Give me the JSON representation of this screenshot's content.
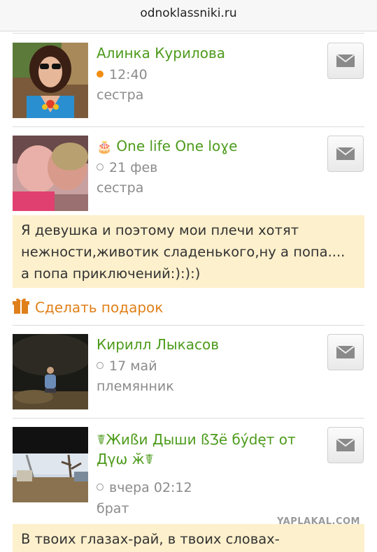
{
  "browser": {
    "url": "odnoklassniki.ru"
  },
  "friends": [
    {
      "name": "Алинка Курилова",
      "time": "12:40",
      "online": true,
      "relation": "сестра"
    },
    {
      "name": "One life One loɣe",
      "birthday_icon": "cake-icon",
      "time": "21 фев",
      "online": false,
      "relation": "сестра",
      "status": "Я девушка и поэтому мои плечи хотят нежности,животик сладенького,ну а попа.... а попа приключений:):):)",
      "gift_label": "Сделать подарок"
    },
    {
      "name": "Кирилл Лыкасов",
      "time": "17 май",
      "online": false,
      "relation": "племянник"
    },
    {
      "name": "☤Жиßи Дыши ßƷё бýdęт от Дγω ӂ☤",
      "name_line1": "☤Жиßи Дыши ßƷё бýdęт от",
      "name_line2": "Дγω ӂ☤",
      "time": "вчера 02:12",
      "online": false,
      "relation": "брат",
      "status": "В твоих глазах-рай, в твоих словах-"
    }
  ],
  "watermark": "YAPLAKAL.COM",
  "colors": {
    "name": "#4d9b1c",
    "gift": "#e0801a",
    "online": "#f28c14",
    "status_bg": "#fdf0cc"
  }
}
